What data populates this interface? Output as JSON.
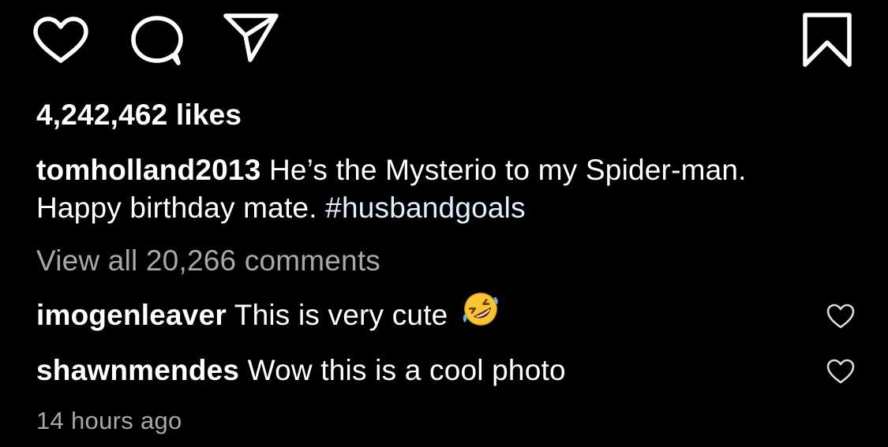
{
  "actions": {
    "like_icon": "heart-outline-icon",
    "comment_icon": "speech-bubble-icon",
    "share_icon": "paper-plane-icon",
    "save_icon": "bookmark-icon"
  },
  "post": {
    "likes": "4,242,462 likes",
    "caption_username": "tomholland2013",
    "caption_text": "He’s the Mysterio to my Spider-man. Happy birthday mate.",
    "caption_hashtag": "#husbandgoals",
    "hashtag_color": "#e0f1ff",
    "view_all_comments": "View all 20,266 comments",
    "timestamp": "14 hours ago"
  },
  "comments": [
    {
      "username": "imogenleaver",
      "text": "This is very cute",
      "emoji": "rolling-on-floor-laughing-emoji"
    },
    {
      "username": "shawnmendes",
      "text": "Wow this is a cool photo"
    }
  ],
  "colors": {
    "background": "#000000",
    "text": "#ffffff",
    "secondary_text": "#a8a8a8"
  }
}
